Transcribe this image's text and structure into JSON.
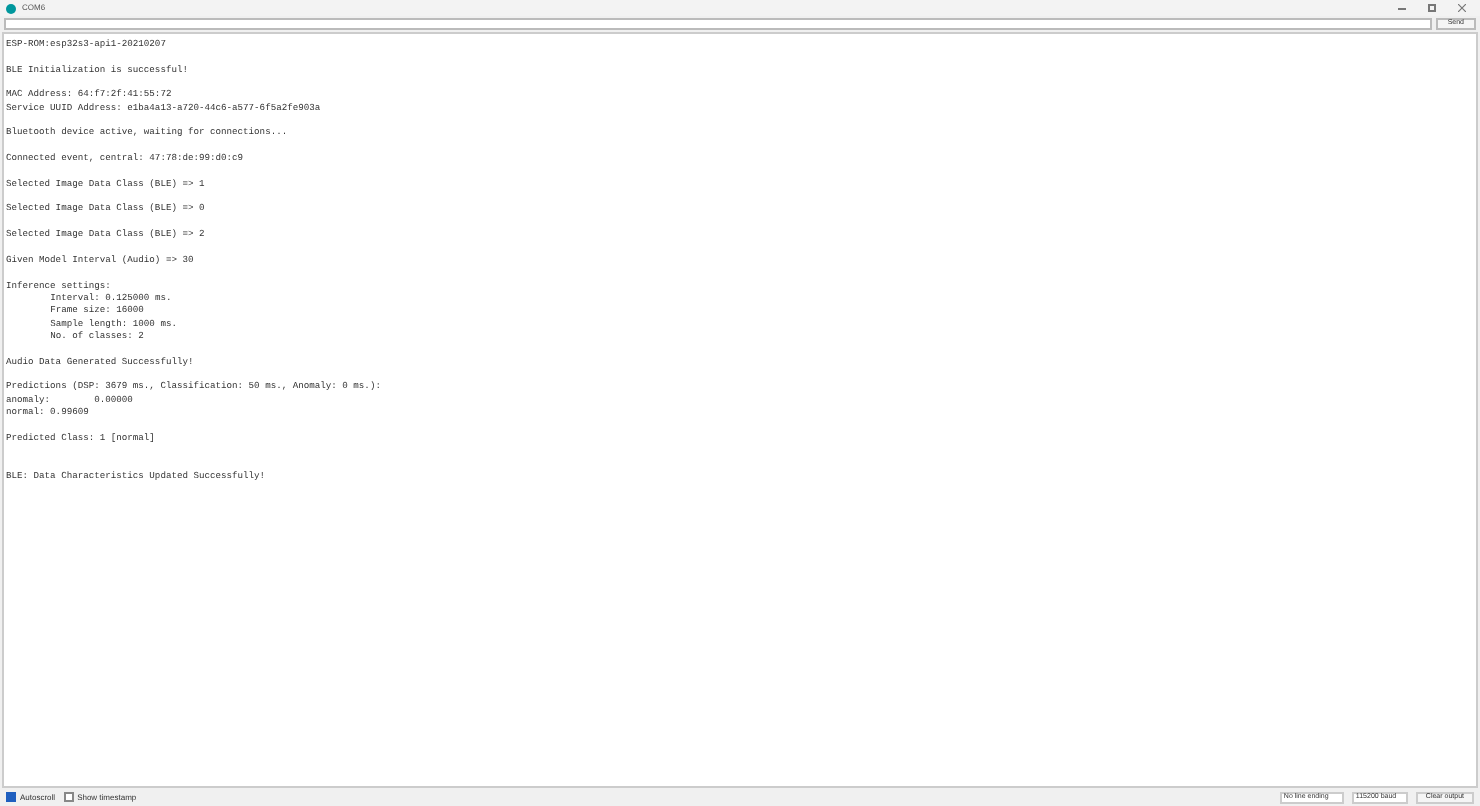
{
  "window": {
    "title": "COM6"
  },
  "input": {
    "button": "Send"
  },
  "output": [
    {
      "kind": "block",
      "lines": [
        "ESP-ROM:esp32s3-api1-20210207"
      ]
    },
    {
      "kind": "block",
      "lines": [
        "BLE Initialization is successful!"
      ]
    },
    {
      "kind": "block",
      "lines": [
        "MAC Address: 64:f7:2f:41:55:72",
        "Service UUID Address: e1ba4a13-a720-44c6-a577-6f5a2fe903a"
      ]
    },
    {
      "kind": "block",
      "lines": [
        "Bluetooth device active, waiting for connections..."
      ]
    },
    {
      "kind": "block",
      "lines": [
        "Connected event, central: 47:78:de:99:d0:c9"
      ]
    },
    {
      "kind": "block",
      "lines": [
        "Selected Image Data Class (BLE) => 1"
      ]
    },
    {
      "kind": "block",
      "lines": [
        "Selected Image Data Class (BLE) => 0"
      ]
    },
    {
      "kind": "block",
      "lines": [
        "Selected Image Data Class (BLE) => 2"
      ]
    },
    {
      "kind": "block",
      "lines": [
        "Given Model Interval (Audio) => 30"
      ]
    },
    {
      "kind": "block",
      "lines": [
        "Inference settings:",
        "\tInterval: 0.125000 ms.",
        "\tFrame size: 16000",
        "\tSample length: 1000 ms.",
        "\tNo. of classes: 2"
      ]
    },
    {
      "kind": "block",
      "lines": [
        "Audio Data Generated Successfully!"
      ]
    },
    {
      "kind": "block",
      "lines": [
        "Predictions (DSP: 3679 ms., Classification: 50 ms., Anomaly: 0 ms.):",
        "anomaly:\t0.00000",
        "normal: 0.99609"
      ]
    },
    {
      "kind": "block",
      "lines": [
        "Predicted Class: 1 [normal]"
      ]
    },
    {
      "kind": "wide",
      "lines": [
        "BLE: Data Characteristics Updated Successfully!"
      ]
    }
  ],
  "footer": {
    "autoscroll": {
      "label": "Autoscroll",
      "checked": true
    },
    "timestamp": {
      "label": "Show timestamp",
      "checked": false
    },
    "line_ending": "No line ending",
    "baud": "115200 baud",
    "clear": "Clear output"
  }
}
